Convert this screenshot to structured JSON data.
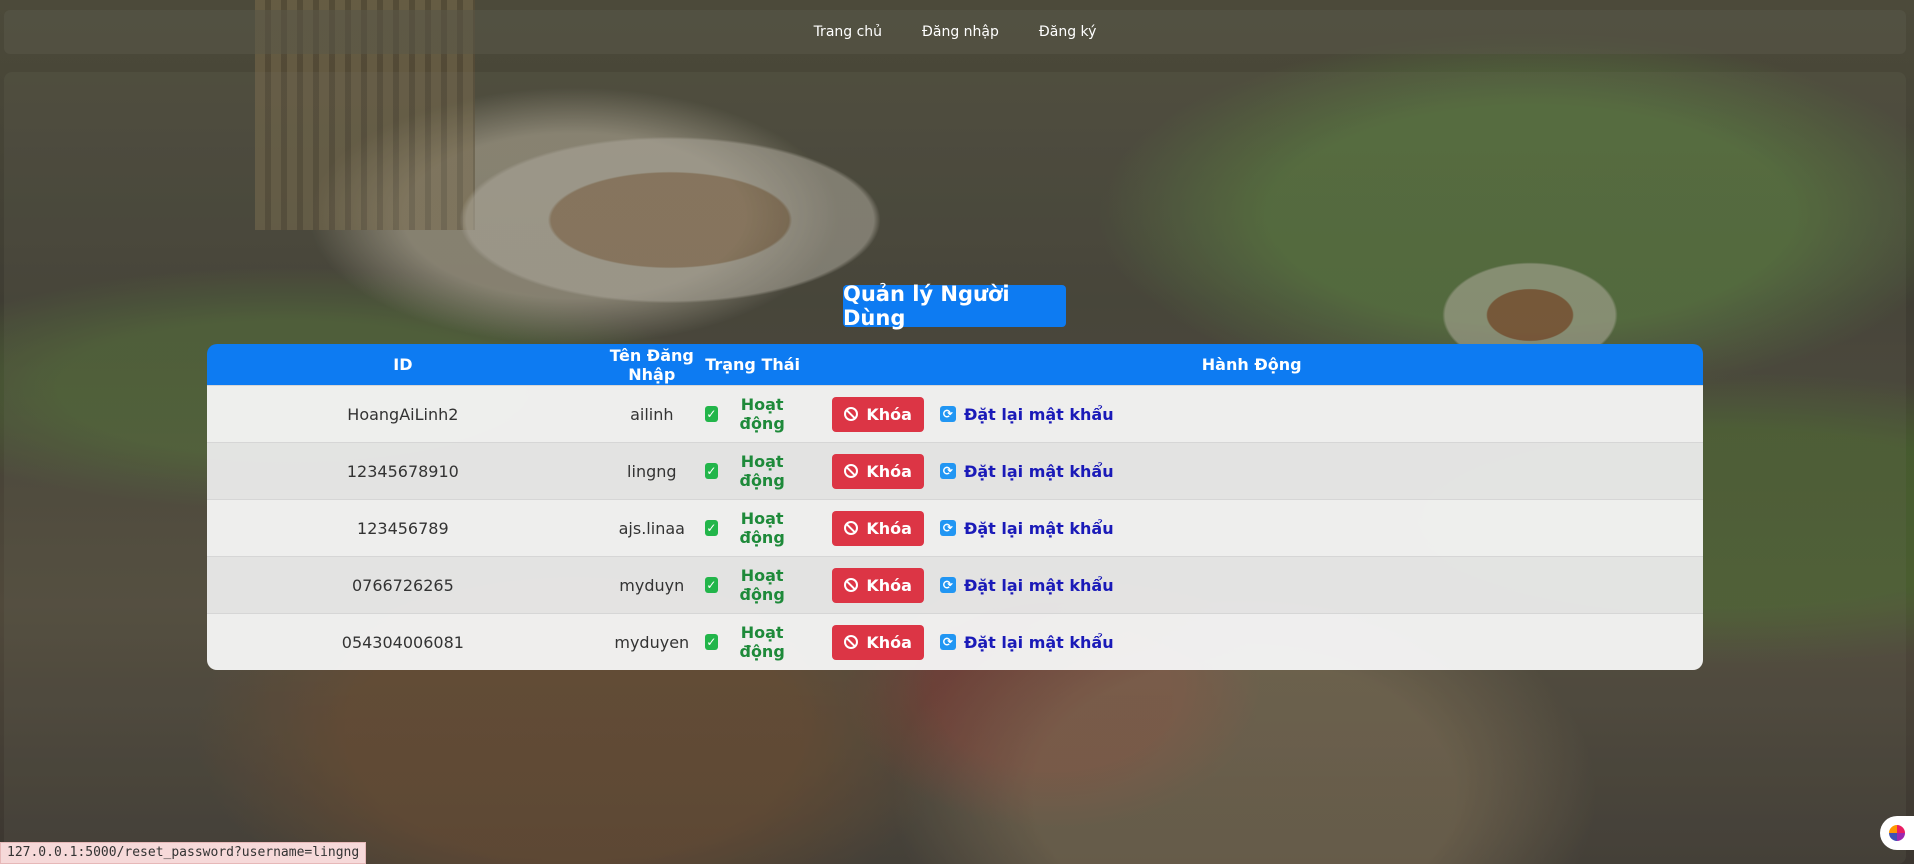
{
  "nav": {
    "items": [
      "Trang chủ",
      "Đăng nhập",
      "Đăng ký"
    ]
  },
  "page": {
    "title": "Quản lý Người Dùng"
  },
  "table": {
    "headers": [
      "ID",
      "Tên Đăng Nhập",
      "Trạng Thái",
      "Hành Động"
    ],
    "rows": [
      {
        "id": "HoangAiLinh2",
        "username": "ailinh",
        "status": "Hoạt động",
        "lock_label": "Khóa",
        "reset_label": "Đặt lại mật khẩu"
      },
      {
        "id": "12345678910",
        "username": "lingng",
        "status": "Hoạt động",
        "lock_label": "Khóa",
        "reset_label": "Đặt lại mật khẩu"
      },
      {
        "id": "123456789",
        "username": "ajs.linaa",
        "status": "Hoạt động",
        "lock_label": "Khóa",
        "reset_label": "Đặt lại mật khẩu"
      },
      {
        "id": "0766726265",
        "username": "myduyn",
        "status": "Hoạt động",
        "lock_label": "Khóa",
        "reset_label": "Đặt lại mật khẩu"
      },
      {
        "id": "054304006081",
        "username": "myduyen",
        "status": "Hoạt động",
        "lock_label": "Khóa",
        "reset_label": "Đặt lại mật khẩu"
      }
    ]
  },
  "status_bar": {
    "url": "127.0.0.1:5000/reset_password?username=lingng"
  },
  "icons": {
    "status": "check-square-icon",
    "lock": "ban-icon",
    "reset": "refresh-icon",
    "widget": "assistant-icon"
  },
  "colors": {
    "primary": "#0d7bf2",
    "danger": "#dc3545",
    "success": "#1e8a3a",
    "link": "#1a1ab8"
  }
}
